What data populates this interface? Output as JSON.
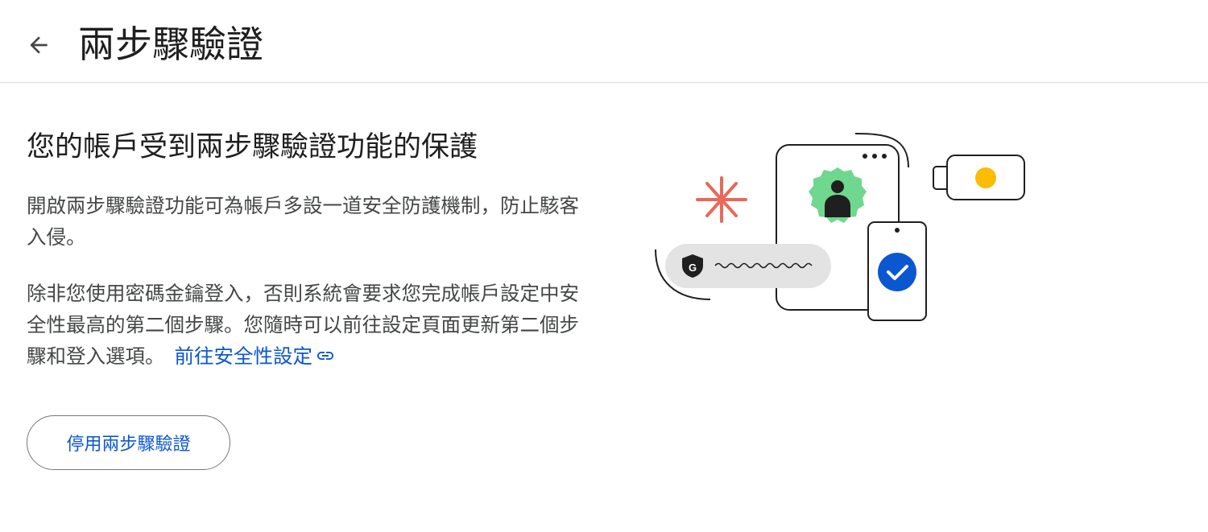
{
  "header": {
    "back_icon": "arrow-back-icon",
    "title": "兩步驟驗證"
  },
  "main": {
    "heading": "您的帳戶受到兩步驟驗證功能的保護",
    "paragraph1": "開啟兩步驟驗證功能可為帳戶多設一道安全防護機制，防止駭客入侵。",
    "paragraph2": "除非您使用密碼金鑰登入，否則系統會要求您完成帳戶設定中安全性最高的第二個步驟。您隨時可以前往設定頁面更新第二個步驟和登入選項。",
    "link_label": "前往安全性設定",
    "link_icon": "link-icon",
    "disable_button": "停用兩步驟驗證"
  },
  "illustration": {
    "shield_letter": "G",
    "icons": [
      "asterisk-icon",
      "user-avatar-icon",
      "shield-icon",
      "check-circle-icon",
      "security-key-icon"
    ]
  },
  "colors": {
    "link": "#0b57d0",
    "title_text": "#1f1f1f",
    "body_text": "#444746",
    "avatar_green": "#6fd88e",
    "check_blue": "#0b57d0",
    "asterisk_red": "#e8695a",
    "key_yellow": "#fbbc04",
    "pill_gray": "#e3e3e3"
  }
}
